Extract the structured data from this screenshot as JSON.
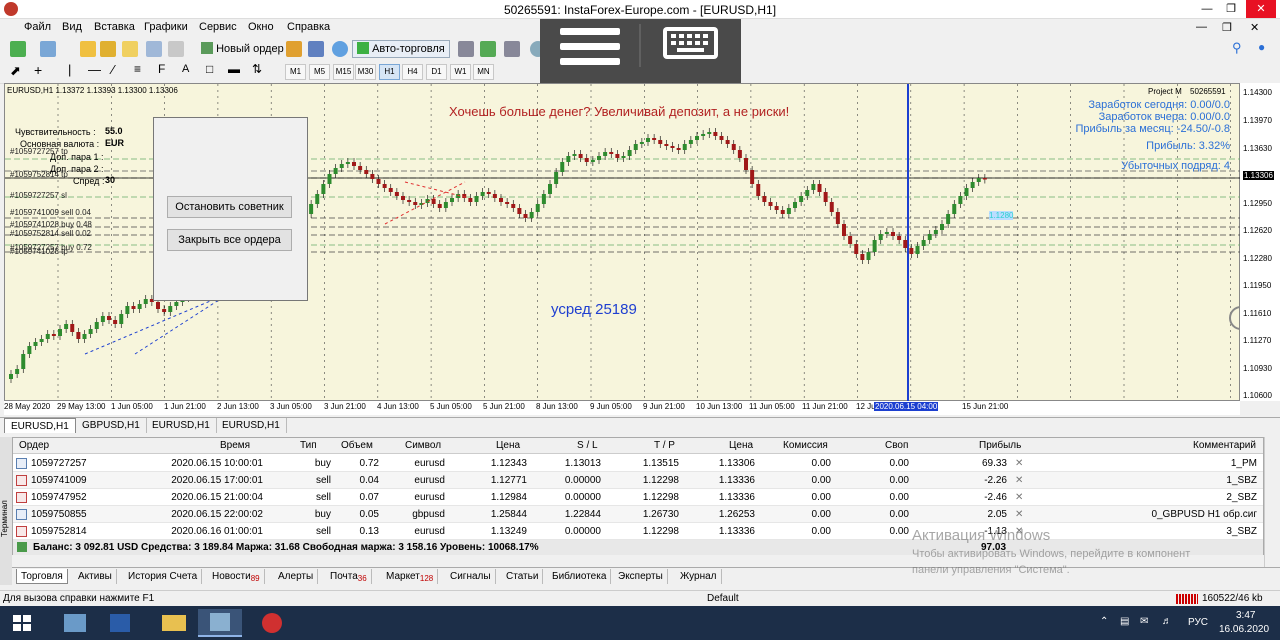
{
  "window": {
    "title": "50265591: InstaForex-Europe.com - [EURUSD,H1]"
  },
  "menu": [
    "Файл",
    "Вид",
    "Вставка",
    "Графики",
    "Сервис",
    "Окно",
    "Справка"
  ],
  "toolbar1": {
    "new_order": "Новый ордер",
    "autotrade": "Авто-торговля"
  },
  "timeframes": [
    "M1",
    "M5",
    "M15",
    "M30",
    "H1",
    "H4",
    "D1",
    "W1",
    "MN"
  ],
  "timeframe_selected": "H1",
  "chart": {
    "header": "EURUSD,H1  1.13372 1.13393 1.13300 1.13306",
    "banner": "Хочешь больше денег? Увеличивай депозит, а не риски!",
    "note": "усред 25189",
    "project": "Project M",
    "account_label": "50265591",
    "stats": [
      "Заработок сегодня: 0.00/0.0",
      "Заработок вчера: 0.00/0.0",
      "Прибыль за месяц: -24.50/-0.8",
      "Прибыль: 3.32%",
      "Убыточных подряд: 4"
    ],
    "price_ticks": [
      "1.14300",
      "1.13970",
      "1.13630",
      "1.13306",
      "1.12950",
      "1.12620",
      "1.12280",
      "1.11950",
      "1.11610",
      "1.11270",
      "1.10930",
      "1.10600"
    ],
    "current_price": "1.13306",
    "line_label": "1.1280",
    "time_ticks": [
      "28 May 2020",
      "29 May 13:00",
      "1 Jun 05:00",
      "1 Jun 21:00",
      "2 Jun 13:00",
      "3 Jun 05:00",
      "3 Jun 21:00",
      "4 Jun 13:00",
      "5 Jun 05:00",
      "5 Jun 21:00",
      "8 Jun 13:00",
      "9 Jun 05:00",
      "9 Jun 21:00",
      "10 Jun 13:00",
      "11 Jun 05:00",
      "11 Jun 21:00",
      "12 Jun 13:00",
      "2020.06.15 04:00",
      "15 Jun 21:00"
    ],
    "order_labels": [
      "#1059727257 tp",
      "#1059752814 tp",
      "#1059727257 sl",
      "#1059741009 sell 0.04",
      "#1059741028 buy 0.48",
      "#1059752814 sell 0.02",
      "#1059727257 buy 0.72",
      "#1059741028 tp"
    ]
  },
  "ea_panel": {
    "sensitivity_label": "Чувствительность :",
    "sensitivity_value": "55.0",
    "currency_label": "Основная валюта :",
    "currency_value": "EUR",
    "pair2": "Доп. пара 1 :",
    "pair3": "Доп. пара 2 :",
    "spread_label": "Спред :",
    "spread_value": "30",
    "stop_button": "Остановить советник",
    "close_button": "Закрыть все ордера"
  },
  "chart_tabs": [
    "EURUSD,H1",
    "GBPUSD,H1",
    "EURUSD,H1",
    "EURUSD,H1"
  ],
  "terminal": {
    "columns": [
      "Ордер",
      "Время",
      "Тип",
      "Объем",
      "Символ",
      "Цена",
      "S / L",
      "T / P",
      "Цена",
      "Комиссия",
      "Своп",
      "Прибыль",
      "Комментарий"
    ],
    "rows": [
      {
        "order": "1059727257",
        "time": "2020.06.15 10:00:01",
        "type": "buy",
        "volume": "0.72",
        "symbol": "eurusd",
        "price": "1.12343",
        "sl": "1.13013",
        "tp": "1.13515",
        "cur": "1.13306",
        "comm": "0.00",
        "swap": "0.00",
        "profit": "69.33",
        "comment": "1_PM"
      },
      {
        "order": "1059741009",
        "time": "2020.06.15 17:00:01",
        "type": "sell",
        "volume": "0.04",
        "symbol": "eurusd",
        "price": "1.12771",
        "sl": "0.00000",
        "tp": "1.12298",
        "cur": "1.13336",
        "comm": "0.00",
        "swap": "0.00",
        "profit": "-2.26",
        "comment": "1_SBZ"
      },
      {
        "order": "1059747952",
        "time": "2020.06.15 21:00:04",
        "type": "sell",
        "volume": "0.07",
        "symbol": "eurusd",
        "price": "1.12984",
        "sl": "0.00000",
        "tp": "1.12298",
        "cur": "1.13336",
        "comm": "0.00",
        "swap": "0.00",
        "profit": "-2.46",
        "comment": "2_SBZ"
      },
      {
        "order": "1059750855",
        "time": "2020.06.15 22:00:02",
        "type": "buy",
        "volume": "0.05",
        "symbol": "gbpusd",
        "price": "1.25844",
        "sl": "1.22844",
        "tp": "1.26730",
        "cur": "1.26253",
        "comm": "0.00",
        "swap": "0.00",
        "profit": "2.05",
        "comment": "0_GBPUSD H1 обр.сиг"
      },
      {
        "order": "1059752814",
        "time": "2020.06.16 01:00:01",
        "type": "sell",
        "volume": "0.13",
        "symbol": "eurusd",
        "price": "1.13249",
        "sl": "0.00000",
        "tp": "1.12298",
        "cur": "1.13336",
        "comm": "0.00",
        "swap": "0.00",
        "profit": "-1.13",
        "comment": "3_SBZ"
      }
    ],
    "balance_line": "Баланс: 3 092.81 USD  Средства: 3 189.84  Маржа: 31.68  Свободная маржа: 3 158.16  Уровень: 10068.17%",
    "total_profit": "97.03",
    "side_label": "Терминал"
  },
  "terminal_tabs": [
    {
      "label": "Торговля"
    },
    {
      "label": "Активы"
    },
    {
      "label": "История Счета"
    },
    {
      "label": "Новости",
      "badge": "89"
    },
    {
      "label": "Алерты"
    },
    {
      "label": "Почта",
      "badge": "36"
    },
    {
      "label": "Маркет",
      "badge": "128"
    },
    {
      "label": "Сигналы"
    },
    {
      "label": "Статьи"
    },
    {
      "label": "Библиотека"
    },
    {
      "label": "Эксперты"
    },
    {
      "label": "Журнал"
    }
  ],
  "watermark": {
    "line1": "Активация Windows",
    "line2": "Чтобы активировать Windows, перейдите в компонент",
    "line3": "панели управления \"Система\"."
  },
  "statusbar": {
    "help": "Для вызова справки нажмите F1",
    "profile": "Default",
    "traffic": "160522/46 kb"
  },
  "taskbar": {
    "lang": "РУС",
    "time": "3:47",
    "date": "16.06.2020"
  }
}
